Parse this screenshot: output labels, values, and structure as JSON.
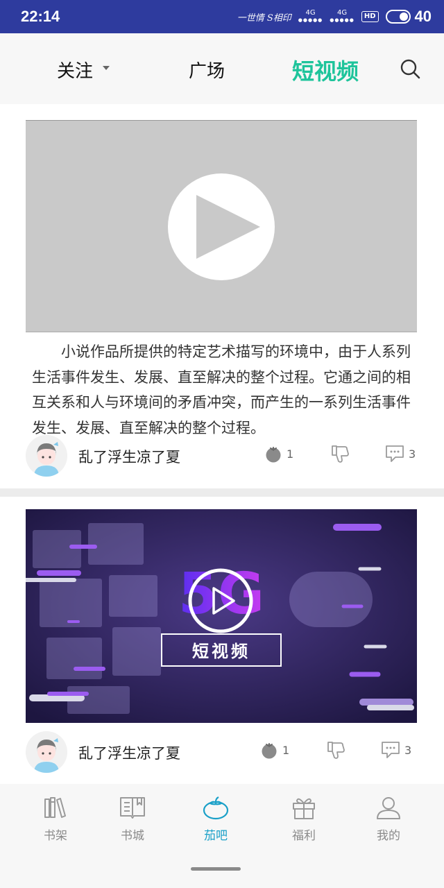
{
  "status_bar": {
    "time": "22:14",
    "decoration": "一世情 S相印",
    "network_1": "4G",
    "network_2": "4G",
    "hd": "HD",
    "battery": "40"
  },
  "top_nav": {
    "follow_label": "关注",
    "square_label": "广场",
    "short_video_label": "短视频",
    "active_color": "#1ec49b"
  },
  "posts": [
    {
      "description": "小说作品所提供的特定艺术描写的环境中，由于人系列生活事件发生、发展、直至解决的整个过程。它通之间的相互关系和人与环境间的矛盾冲突，而产生的一系列生活事件发生、发展、直至解决的整个过程。",
      "username": "乱了浮生凉了夏",
      "tomato_count": "1",
      "comment_count": "3"
    },
    {
      "video_title_5g": "5G",
      "video_caption": "短视频",
      "username": "乱了浮生凉了夏",
      "tomato_count": "1",
      "comment_count": "3"
    }
  ],
  "bottom_nav": {
    "items": [
      {
        "label": "书架",
        "icon": "bookshelf-icon"
      },
      {
        "label": "书城",
        "icon": "book-icon"
      },
      {
        "label": "茄吧",
        "icon": "tomato-icon",
        "active": true
      },
      {
        "label": "福利",
        "icon": "gift-icon"
      },
      {
        "label": "我的",
        "icon": "user-icon"
      }
    ],
    "active_color": "#1aa0c8"
  }
}
